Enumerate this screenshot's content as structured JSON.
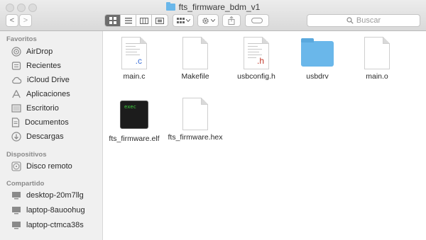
{
  "window": {
    "title": "fts_firmware_bdm_v1"
  },
  "toolbar": {
    "back_label": "<",
    "forward_label": ">",
    "search_placeholder": "Buscar"
  },
  "sidebar": {
    "favorites_title": "Favoritos",
    "favorites": [
      {
        "label": "AirDrop",
        "icon": "airdrop-icon"
      },
      {
        "label": "Recientes",
        "icon": "recents-icon"
      },
      {
        "label": "iCloud Drive",
        "icon": "cloud-icon"
      },
      {
        "label": "Aplicaciones",
        "icon": "applications-icon"
      },
      {
        "label": "Escritorio",
        "icon": "desktop-icon"
      },
      {
        "label": "Documentos",
        "icon": "documents-icon"
      },
      {
        "label": "Descargas",
        "icon": "downloads-icon"
      }
    ],
    "devices_title": "Dispositivos",
    "devices": [
      {
        "label": "Disco remoto",
        "icon": "disc-icon"
      }
    ],
    "shared_title": "Compartido",
    "shared": [
      {
        "label": "desktop-20m7llg",
        "icon": "computer-icon"
      },
      {
        "label": "laptop-8auoohug",
        "icon": "computer-icon"
      },
      {
        "label": "laptop-ctmca38s",
        "icon": "computer-icon"
      }
    ]
  },
  "files": [
    {
      "name": "main.c",
      "kind": "c-source",
      "ext": ".c",
      "ext_color": "#3b6fd6"
    },
    {
      "name": "Makefile",
      "kind": "document"
    },
    {
      "name": "usbconfig.h",
      "kind": "c-header",
      "ext": ".h",
      "ext_color": "#c0392b"
    },
    {
      "name": "usbdrv",
      "kind": "folder",
      "color": "#6ab7ea"
    },
    {
      "name": "main.o",
      "kind": "document"
    },
    {
      "name": "fts_firmware.elf",
      "kind": "executable",
      "badge": "exec"
    },
    {
      "name": "fts_firmware.hex",
      "kind": "document"
    }
  ]
}
